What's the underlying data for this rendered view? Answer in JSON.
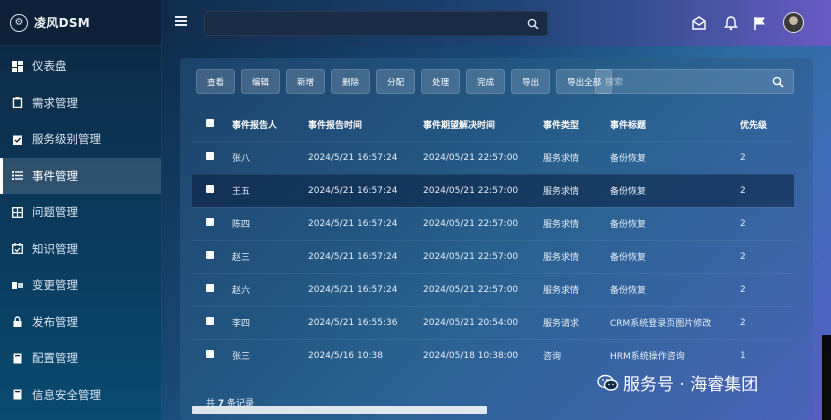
{
  "brand": {
    "name": "凌风DSM",
    "logo_glyph": "⚙"
  },
  "sidebar": {
    "items": [
      {
        "label": "仪表盘",
        "icon": "dashboard-icon"
      },
      {
        "label": "需求管理",
        "icon": "clipboard-icon"
      },
      {
        "label": "服务级别管理",
        "icon": "clipboard-check-icon"
      },
      {
        "label": "事件管理",
        "icon": "list-icon",
        "active": true
      },
      {
        "label": "问题管理",
        "icon": "grid-icon"
      },
      {
        "label": "知识管理",
        "icon": "calendar-check-icon"
      },
      {
        "label": "变更管理",
        "icon": "exchange-icon"
      },
      {
        "label": "发布管理",
        "icon": "lock-icon"
      },
      {
        "label": "配置管理",
        "icon": "book-icon"
      },
      {
        "label": "信息安全管理",
        "icon": "book-icon"
      }
    ]
  },
  "header": {
    "search_placeholder": "",
    "icons": [
      "mail-open-icon",
      "bell-icon",
      "flag-icon"
    ]
  },
  "toolbar": {
    "buttons": [
      "查看",
      "编辑",
      "新增",
      "删除",
      "分配",
      "处理",
      "完成",
      "导出",
      "导出全部"
    ],
    "search_placeholder": "搜索"
  },
  "table": {
    "headers": [
      "事件报告人",
      "事件报告时间",
      "事件期望解决时间",
      "事件类型",
      "事件标题",
      "优先级"
    ],
    "rows": [
      [
        "张八",
        "2024/5/21 16:57:24",
        "2024/05/21 22:57:00",
        "服务求情",
        "备份恢复",
        "2"
      ],
      [
        "王五",
        "2024/5/21 16:57:24",
        "2024/05/21 22:57:00",
        "服务求情",
        "备份恢复",
        "2"
      ],
      [
        "陈四",
        "2024/5/21 16:57:24",
        "2024/05/21 22:57:00",
        "服务求情",
        "备份恢复",
        "2"
      ],
      [
        "赵三",
        "2024/5/21 16:57:24",
        "2024/05/21 22:57:00",
        "服务求情",
        "备份恢复",
        "2"
      ],
      [
        "赵六",
        "2024/5/21 16:57:24",
        "2024/05/21 22:57:00",
        "服务求情",
        "备份恢复",
        "2"
      ],
      [
        "李四",
        "2024/5/21 16:55:36",
        "2024/05/21 20:54:00",
        "服务请求",
        "CRM系统登录页图片修改",
        "2"
      ],
      [
        "张三",
        "2024/5/16 10:38",
        "2024/05/18 10:38:00",
        "咨询",
        "HRM系统操作咨询",
        "1"
      ]
    ],
    "selected_row": 1
  },
  "footer": {
    "prefix": "共",
    "count": "7",
    "suffix": "条记录"
  },
  "watermark": "服务号 · 海睿集团"
}
